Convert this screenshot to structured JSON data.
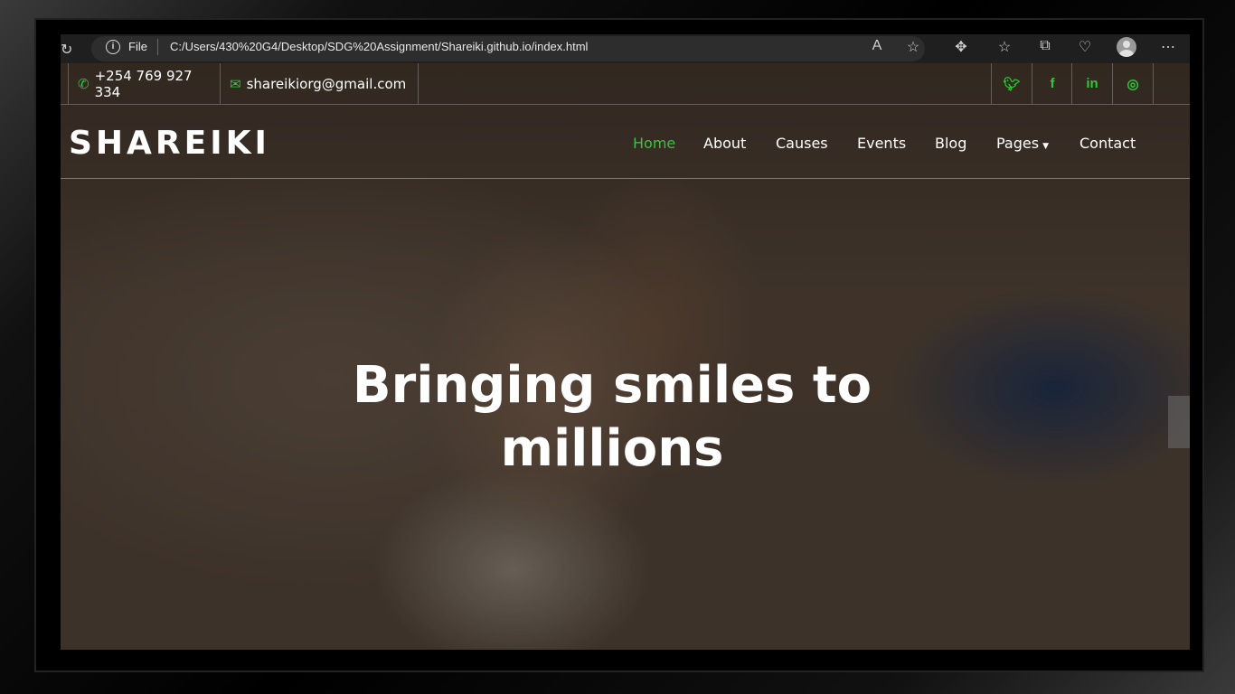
{
  "browser": {
    "file_label": "File",
    "url": "C:/Users/430%20G4/Desktop/SDG%20Assignment/Shareiki.github.io/index.html",
    "icons": [
      "reload-icon",
      "info-icon",
      "read-aloud-icon",
      "favorite-star-icon",
      "extensions-icon",
      "favorites-icon",
      "collections-icon",
      "health-icon",
      "profile-avatar",
      "more-icon"
    ]
  },
  "topbar": {
    "phone": "+254 769 927 334",
    "email": "shareikiorg@gmail.com",
    "social": [
      "twitter-icon",
      "facebook-icon",
      "linkedin-icon",
      "instagram-icon"
    ]
  },
  "site": {
    "logo": "SHAREIKI"
  },
  "nav": {
    "items": [
      "Home",
      "About",
      "Causes",
      "Events",
      "Blog",
      "Pages",
      "Contact"
    ],
    "active": "Home"
  },
  "hero": {
    "line1": "Bringing smiles to",
    "line2": "millions"
  },
  "colors": {
    "accent": "#2ec937",
    "text": "#ffffff"
  }
}
